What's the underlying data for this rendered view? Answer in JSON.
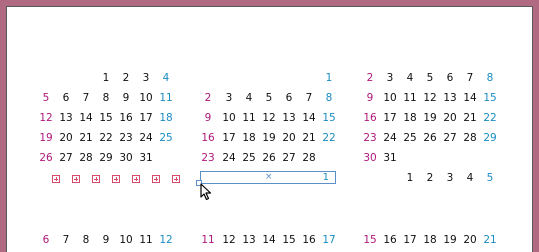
{
  "colors": {
    "frame": "#b06a82",
    "sunday": "#b0187b",
    "saturday": "#1a8cc1",
    "weekday": "#111111",
    "selection": "#5b8fc7",
    "add_box": "#d84a6a"
  },
  "calendars": [
    {
      "weeks": [
        [
          "",
          "",
          "",
          "1",
          "2",
          "3",
          "4"
        ],
        [
          "5",
          "6",
          "7",
          "8",
          "9",
          "10",
          "11"
        ],
        [
          "12",
          "13",
          "14",
          "15",
          "16",
          "17",
          "18"
        ],
        [
          "19",
          "20",
          "21",
          "22",
          "23",
          "24",
          "25"
        ],
        [
          "26",
          "27",
          "28",
          "29",
          "30",
          "31",
          ""
        ]
      ]
    },
    {
      "weeks": [
        [
          "",
          "",
          "",
          "",
          "",
          "",
          "1"
        ],
        [
          "2",
          "3",
          "4",
          "5",
          "6",
          "7",
          "8"
        ],
        [
          "9",
          "10",
          "11",
          "12",
          "13",
          "14",
          "15"
        ],
        [
          "16",
          "17",
          "18",
          "19",
          "20",
          "21",
          "22"
        ],
        [
          "23",
          "24",
          "25",
          "26",
          "27",
          "28",
          ""
        ]
      ]
    },
    {
      "weeks": [
        [
          "2",
          "3",
          "4",
          "5",
          "6",
          "7",
          "8"
        ],
        [
          "9",
          "10",
          "11",
          "12",
          "13",
          "14",
          "15"
        ],
        [
          "16",
          "17",
          "18",
          "19",
          "20",
          "21",
          "22"
        ],
        [
          "23",
          "24",
          "25",
          "26",
          "27",
          "28",
          "29"
        ],
        [
          "30",
          "31",
          "",
          "",
          "",
          "",
          ""
        ]
      ]
    }
  ],
  "row6_right": [
    "1",
    "2",
    "3",
    "4",
    "5"
  ],
  "bottom_row": {
    "left": [
      "6",
      "7",
      "8",
      "9",
      "10",
      "11",
      "12"
    ],
    "middle": [
      "11",
      "12",
      "13",
      "14",
      "15",
      "16",
      "17"
    ],
    "right": [
      "15",
      "16",
      "17",
      "18",
      "19",
      "20",
      "21"
    ]
  },
  "add_buttons_count": 7,
  "editor": {
    "close_symbol": "×",
    "value": "1"
  }
}
